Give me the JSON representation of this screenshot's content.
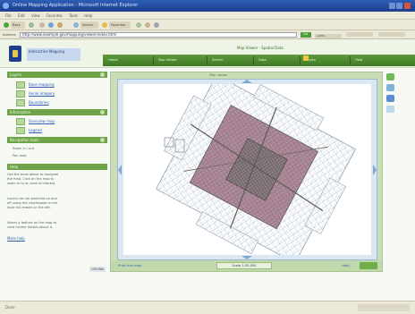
{
  "browser": {
    "window_title": "Online Mapping Application - Microsoft Internet Explorer",
    "menu": [
      "File",
      "Edit",
      "View",
      "Favorites",
      "Tools",
      "Help"
    ],
    "toolbar": {
      "back_label": "Back",
      "search_label": "Search",
      "favorites_label": "Favorites"
    },
    "address": {
      "label": "Address",
      "value": "http://www.example.gov/mapping/viewer/index.html",
      "go_label": "Go",
      "links_label": "Links"
    },
    "status_text": "Done"
  },
  "site": {
    "title": "Interactive Mapping",
    "nav_caption": "Map Viewer · Spatial Data",
    "nav": [
      "Home",
      "Map Viewer",
      "Search",
      "Data",
      "Layers",
      "Help"
    ]
  },
  "sidebar": {
    "section1": {
      "title": "Layers",
      "items": [
        "Base mapping",
        "Aerial imagery",
        "Boundaries"
      ]
    },
    "section2": {
      "title": "Information",
      "items": [
        "Overview map",
        "Legend"
      ]
    },
    "section3": {
      "title": "Navigation tools",
      "items": [
        "Zoom in / out",
        "Pan map"
      ]
    },
    "section4": {
      "title": "Help",
      "text": [
        "Use the tools above to navigate",
        "the map. Click on the map to",
        "zoom in to an area of interest.",
        "",
        "Layers can be switched on and",
        "off using the checkboxes in the",
        "layer list shown on the left.",
        "",
        "Select a feature on the map to",
        "view further details about it."
      ],
      "link": "More help"
    },
    "badge": "CROWN"
  },
  "map": {
    "top_caption": "Map viewer",
    "footer_left": "Print this map",
    "scale_text": "Scale 1:25,000",
    "footer_right": "Help"
  },
  "colors": {
    "nav_green": "#4c8a2e",
    "accent_yellow": "#f1c63b",
    "link_blue": "#2e5fb0",
    "map_pink": "#c89ab0",
    "map_gray": "#7c7a74"
  },
  "tools": [
    "zoom-in-icon",
    "zoom-out-icon",
    "pan-icon",
    "info-icon"
  ]
}
